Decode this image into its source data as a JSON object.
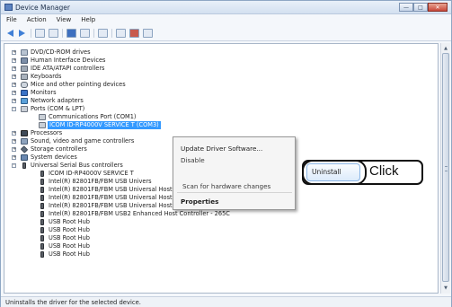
{
  "window": {
    "title": "Device Manager"
  },
  "menu": [
    "File",
    "Action",
    "View",
    "Help"
  ],
  "tree": [
    {
      "label": "DVD/CD-ROM drives",
      "icon": "drive-icon"
    },
    {
      "label": "Human Interface Devices",
      "icon": "hid-icon"
    },
    {
      "label": "IDE ATA/ATAPI controllers",
      "icon": "ide-icon"
    },
    {
      "label": "Keyboards",
      "icon": "keyboard-icon"
    },
    {
      "label": "Mice and other pointing devices",
      "icon": "mouse-icon"
    },
    {
      "label": "Monitors",
      "icon": "monitor-icon"
    },
    {
      "label": "Network adapters",
      "icon": "network-icon"
    },
    {
      "label": "Ports (COM & LPT)",
      "icon": "port-icon"
    },
    {
      "label": "Communications Port (COM1)",
      "icon": "port-icon"
    },
    {
      "label": "ICOM ID-RP4000V SERVICE T (COM3)",
      "icon": "port-icon"
    },
    {
      "label": "Processors",
      "icon": "processor-icon"
    },
    {
      "label": "Sound, video and game controllers",
      "icon": "sound-icon"
    },
    {
      "label": "Storage controllers",
      "icon": "storage-icon"
    },
    {
      "label": "System devices",
      "icon": "system-icon"
    },
    {
      "label": "Universal Serial Bus controllers",
      "icon": "usb-icon"
    },
    {
      "label": "ICOM ID-RP4000V SERVICE T",
      "icon": "usb-icon"
    },
    {
      "label": "Intel(R) 82801FB/FBM USB Univers",
      "icon": "usb-icon"
    },
    {
      "label": "Intel(R) 82801FB/FBM USB Universal Host Controller - 2659",
      "icon": "usb-icon"
    },
    {
      "label": "Intel(R) 82801FB/FBM USB Universal Host Controller - 265A",
      "icon": "usb-icon"
    },
    {
      "label": "Intel(R) 82801FB/FBM USB Universal Host Controller - 265B",
      "icon": "usb-icon"
    },
    {
      "label": "Intel(R) 82801FB/FBM USB2 Enhanced Host Controller - 265C",
      "icon": "usb-icon"
    },
    {
      "label": "USB Root Hub",
      "icon": "usb-icon"
    },
    {
      "label": "USB Root Hub",
      "icon": "usb-icon"
    },
    {
      "label": "USB Root Hub",
      "icon": "usb-icon"
    },
    {
      "label": "USB Root Hub",
      "icon": "usb-icon"
    },
    {
      "label": "USB Root Hub",
      "icon": "usb-icon"
    }
  ],
  "context_menu": {
    "update": "Update Driver Software...",
    "disable": "Disable",
    "uninstall": "Uninstall",
    "scan": "Scan for hardware changes",
    "properties": "Properties"
  },
  "callout": {
    "text": "Click"
  },
  "status": {
    "text": "Uninstalls the driver for the selected device."
  }
}
